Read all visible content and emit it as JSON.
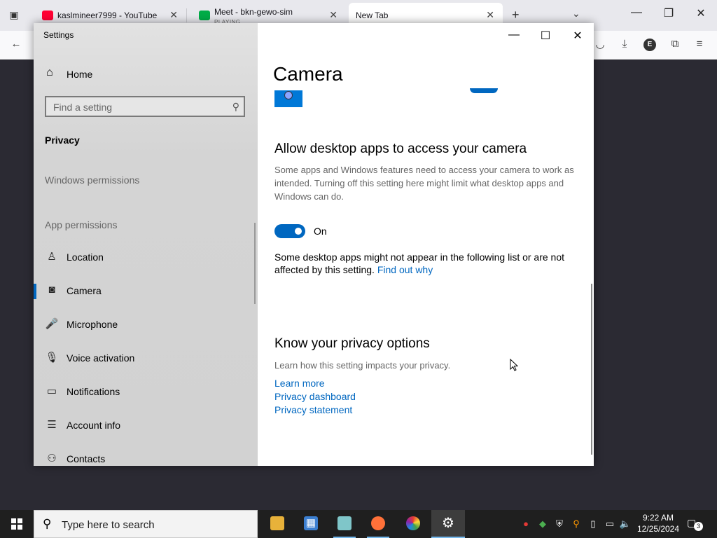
{
  "browser": {
    "tabs": [
      {
        "title": "kaslmineer7999 - YouTube",
        "close": "✕",
        "favicon_color": "#ff0033"
      },
      {
        "title": "Meet - bkn-gewo-sim",
        "subtitle": "PLAYING",
        "close": "✕",
        "favicon_color": "#00ac47"
      },
      {
        "title": "New Tab",
        "close": "✕",
        "favicon_color": ""
      }
    ],
    "new_tab": "+",
    "overflow": "⌄",
    "controls": {
      "minimize": "—",
      "restore": "❐",
      "close": "✕"
    },
    "nav": {
      "back": "←",
      "pocket": "◡",
      "download": "⤓",
      "profile": "E",
      "extensions": "⧉",
      "menu": "≡"
    }
  },
  "settings": {
    "window_title": "Settings",
    "controls": {
      "minimize": "—",
      "maximize": "☐",
      "close": "✕"
    },
    "sidebar": {
      "home": "Home",
      "search_placeholder": "Find a setting",
      "section_title": "Privacy",
      "windows_permissions": "Windows permissions",
      "app_permissions": "App permissions",
      "items": [
        {
          "label": "Location",
          "icon": "location-icon",
          "glyph": "♙",
          "active": false
        },
        {
          "label": "Camera",
          "icon": "camera-icon",
          "glyph": "◙",
          "active": true
        },
        {
          "label": "Microphone",
          "icon": "microphone-icon",
          "glyph": "🎤",
          "active": false
        },
        {
          "label": "Voice activation",
          "icon": "voice-activation-icon",
          "glyph": "🎙",
          "active": false
        },
        {
          "label": "Notifications",
          "icon": "notifications-icon",
          "glyph": "▭",
          "active": false
        },
        {
          "label": "Account info",
          "icon": "account-info-icon",
          "glyph": "☰",
          "active": false
        },
        {
          "label": "Contacts",
          "icon": "contacts-icon",
          "glyph": "⚇",
          "active": false
        }
      ]
    },
    "main": {
      "page_title": "Camera",
      "desktop_section": {
        "heading": "Allow desktop apps to access your camera",
        "description": "Some apps and Windows features need to access your camera to work as intended. Turning off this setting here might limit what desktop apps and Windows can do.",
        "toggle_state": "On",
        "note": "Some desktop apps might not appear in the following list or are not affected by this setting.",
        "note_link": "Find out why"
      },
      "privacy_section": {
        "heading": "Know your privacy options",
        "description": "Learn how this setting impacts your privacy.",
        "links": [
          "Learn more",
          "Privacy dashboard",
          "Privacy statement"
        ]
      }
    }
  },
  "taskbar": {
    "search_placeholder": "Type here to search",
    "clock_time": "9:22 AM",
    "clock_date": "12/25/2024",
    "notification_count": "3",
    "accent": "#76b9ed"
  },
  "colors": {
    "accent": "#0067c0",
    "link": "#0067c0"
  }
}
